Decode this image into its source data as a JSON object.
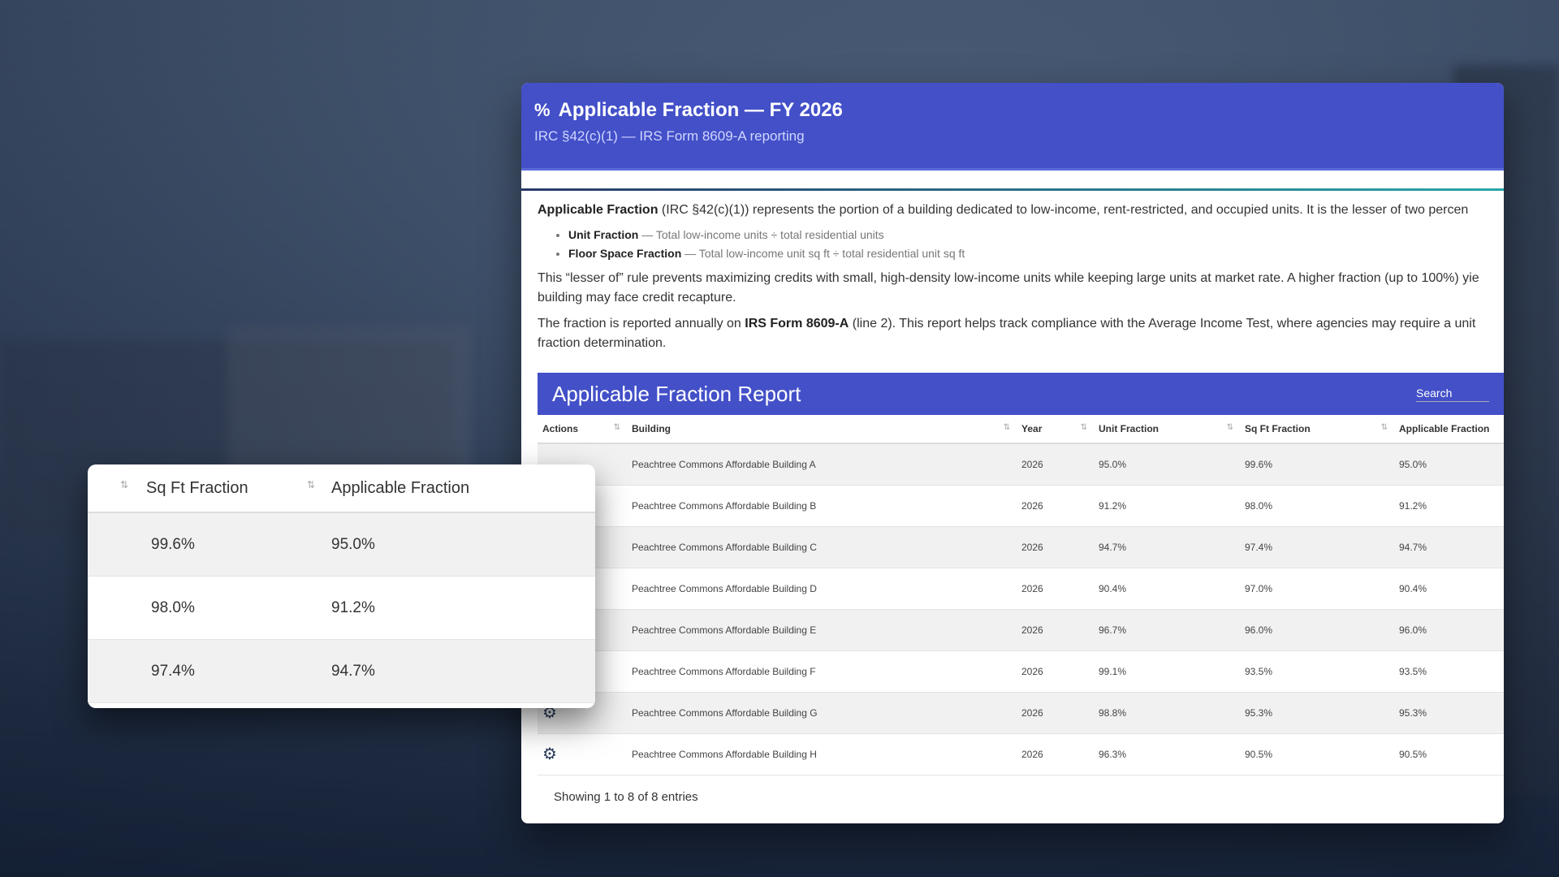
{
  "header": {
    "title": "Applicable Fraction — FY 2026",
    "subtitle": "IRC §42(c)(1) — IRS Form 8609-A reporting",
    "icon": "percent-icon"
  },
  "description": {
    "intro_bold": "Applicable Fraction",
    "intro_rest": " (IRC §42(c)(1)) represents the portion of a building dedicated to low-income, rent-restricted, and occupied units. It is the lesser of two percen",
    "bullets": [
      {
        "label": "Unit Fraction",
        "text": " — Total low-income units ÷ total residential units"
      },
      {
        "label": "Floor Space Fraction",
        "text": " — Total low-income unit sq ft ÷ total residential unit sq ft"
      }
    ],
    "para2": "This “lesser of” rule prevents maximizing credits with small, high-density low-income units while keeping large units at market rate. A higher fraction (up to 100%) yie building may face credit recapture.",
    "para3_pre": "The fraction is reported annually on ",
    "para3_bold": "IRS Form 8609-A",
    "para3_post": " (line 2). This report helps track compliance with the Average Income Test, where agencies may require a unit fraction determination."
  },
  "report": {
    "title": "Applicable Fraction Report",
    "search_label": "Search",
    "columns": [
      "Actions",
      "Building",
      "Year",
      "Unit Fraction",
      "Sq Ft Fraction",
      "Applicable Fraction"
    ],
    "rows": [
      {
        "building": "Peachtree Commons Affordable Building A",
        "year": "2026",
        "unit": "95.0%",
        "sqft": "99.6%",
        "applicable": "95.0%"
      },
      {
        "building": "Peachtree Commons Affordable Building B",
        "year": "2026",
        "unit": "91.2%",
        "sqft": "98.0%",
        "applicable": "91.2%"
      },
      {
        "building": "Peachtree Commons Affordable Building C",
        "year": "2026",
        "unit": "94.7%",
        "sqft": "97.4%",
        "applicable": "94.7%"
      },
      {
        "building": "Peachtree Commons Affordable Building D",
        "year": "2026",
        "unit": "90.4%",
        "sqft": "97.0%",
        "applicable": "90.4%"
      },
      {
        "building": "Peachtree Commons Affordable Building E",
        "year": "2026",
        "unit": "96.7%",
        "sqft": "96.0%",
        "applicable": "96.0%"
      },
      {
        "building": "Peachtree Commons Affordable Building F",
        "year": "2026",
        "unit": "99.1%",
        "sqft": "93.5%",
        "applicable": "93.5%"
      },
      {
        "building": "Peachtree Commons Affordable Building G",
        "year": "2026",
        "unit": "98.8%",
        "sqft": "95.3%",
        "applicable": "95.3%"
      },
      {
        "building": "Peachtree Commons Affordable Building H",
        "year": "2026",
        "unit": "96.3%",
        "sqft": "90.5%",
        "applicable": "90.5%"
      }
    ],
    "footer": "Showing 1 to 8 of 8 entries"
  },
  "zoom": {
    "columns": [
      "Sq Ft Fraction",
      "Applicable Fraction"
    ],
    "rows": [
      {
        "sqft": "99.6%",
        "applicable": "95.0%"
      },
      {
        "sqft": "98.0%",
        "applicable": "91.2%"
      },
      {
        "sqft": "97.4%",
        "applicable": "94.7%"
      }
    ]
  }
}
